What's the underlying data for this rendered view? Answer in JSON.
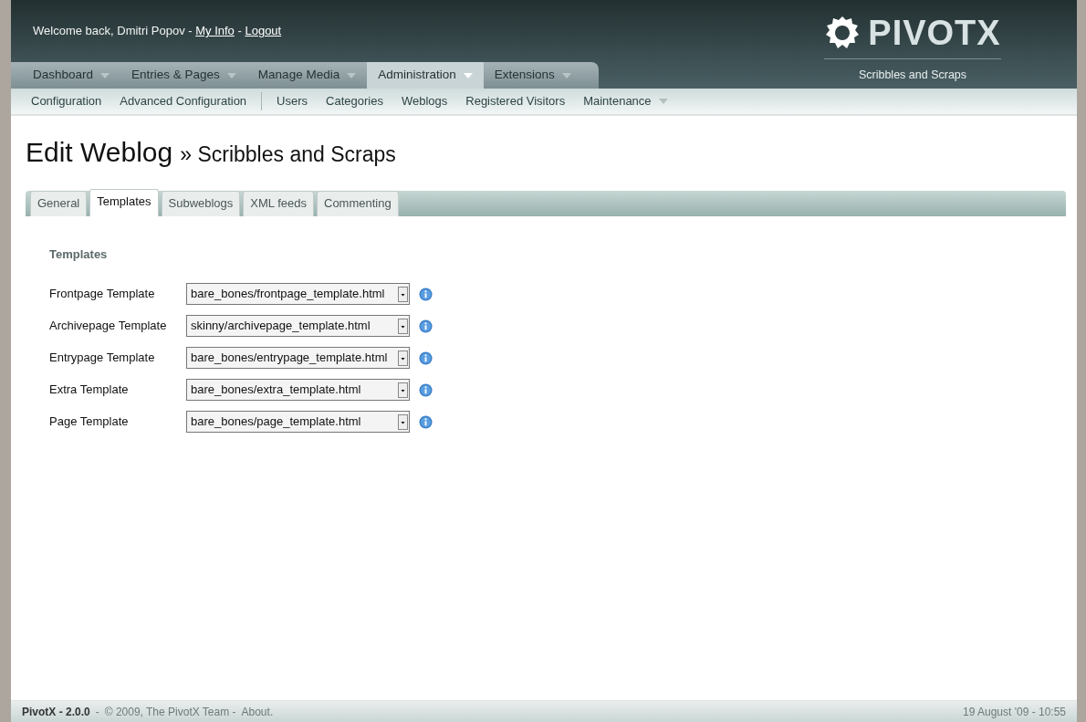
{
  "header": {
    "welcome": "Welcome back, Dmitri Popov -",
    "my_info": "My Info",
    "separator": "-",
    "logout": "Logout",
    "logo_text": "PIVOTX",
    "site_name": "Scribbles and Scraps"
  },
  "main_nav": [
    {
      "label": "Dashboard",
      "selected": false
    },
    {
      "label": "Entries & Pages",
      "selected": false
    },
    {
      "label": "Manage Media",
      "selected": false
    },
    {
      "label": "Administration",
      "selected": true
    },
    {
      "label": "Extensions",
      "selected": false
    }
  ],
  "sub_nav": [
    {
      "label": "Configuration",
      "divider_after": false,
      "dropdown": false
    },
    {
      "label": "Advanced Configuration",
      "divider_after": true,
      "dropdown": false
    },
    {
      "label": "Users",
      "divider_after": false,
      "dropdown": false
    },
    {
      "label": "Categories",
      "divider_after": false,
      "dropdown": false
    },
    {
      "label": "Weblogs",
      "divider_after": false,
      "dropdown": false
    },
    {
      "label": "Registered Visitors",
      "divider_after": false,
      "dropdown": false
    },
    {
      "label": "Maintenance",
      "divider_after": false,
      "dropdown": true
    }
  ],
  "title": {
    "main": "Edit Weblog",
    "sub": "» Scribbles and Scraps"
  },
  "tabs": [
    {
      "label": "General",
      "selected": false
    },
    {
      "label": "Templates",
      "selected": true
    },
    {
      "label": "Subweblogs",
      "selected": false
    },
    {
      "label": "XML feeds",
      "selected": false
    },
    {
      "label": "Commenting",
      "selected": false
    }
  ],
  "section_title": "Templates",
  "fields": [
    {
      "label": "Frontpage Template",
      "value": "bare_bones/frontpage_template.html"
    },
    {
      "label": "Archivepage Template",
      "value": "skinny/archivepage_template.html"
    },
    {
      "label": "Entrypage Template",
      "value": "bare_bones/entrypage_template.html"
    },
    {
      "label": "Extra Template",
      "value": "bare_bones/extra_template.html"
    },
    {
      "label": "Page Template",
      "value": "bare_bones/page_template.html"
    }
  ],
  "footer": {
    "version": "PivotX - 2.0.0",
    "separator": "-",
    "copyright": "© 2009, The PivotX Team -",
    "about": "About.",
    "date": "19 August '09 - 10:55"
  }
}
